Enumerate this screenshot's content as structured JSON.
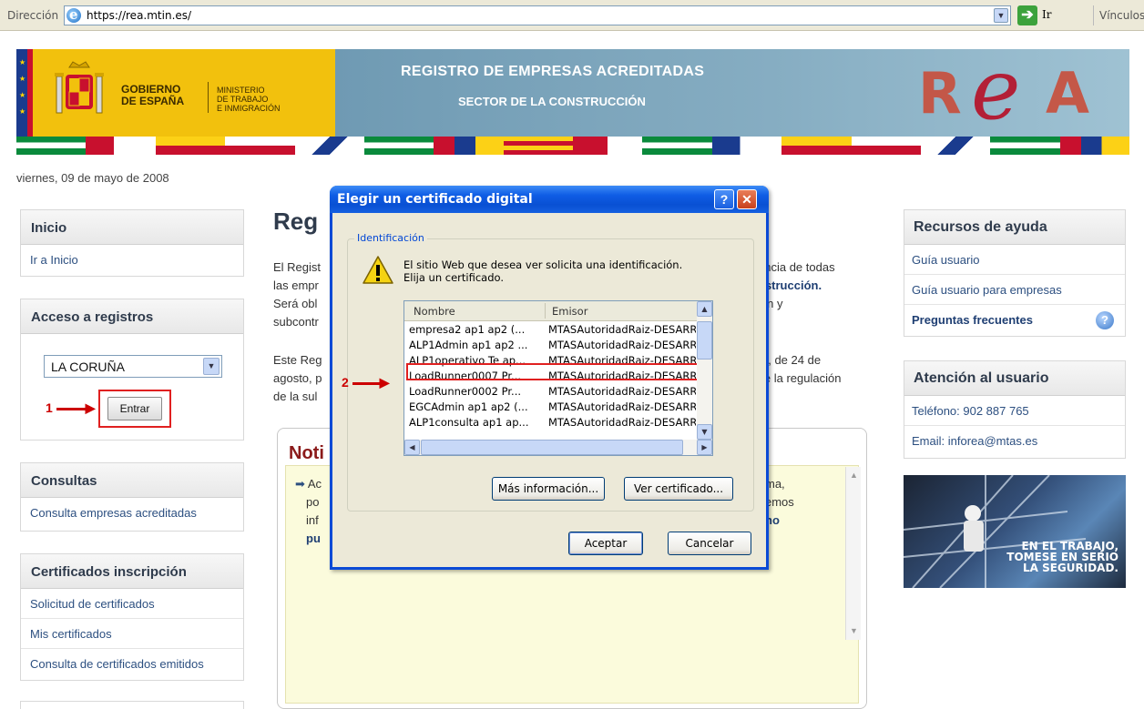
{
  "browser": {
    "address_label": "Dirección",
    "url": "https://rea.mtin.es/",
    "go_label": "Ir",
    "links_label": "Vínculos"
  },
  "banner": {
    "gobierno": "GOBIERNO\nDE ESPAÑA",
    "ministerio": "MINISTERIO\nDE TRABAJO\nE INMIGRACIÓN",
    "title": "REGISTRO DE EMPRESAS ACREDITADAS",
    "subtitle": "SECTOR DE LA CONSTRUCCIÓN",
    "logo_text": "REA"
  },
  "date": "viernes, 09 de mayo de 2008",
  "left": {
    "inicio": {
      "title": "Inicio",
      "items": [
        "Ir a Inicio"
      ]
    },
    "acceso": {
      "title": "Acceso a registros",
      "selected_province": "LA CORUÑA",
      "enter_label": "Entrar"
    },
    "consultas": {
      "title": "Consultas",
      "items": [
        "Consulta empresas acreditadas"
      ]
    },
    "certificados": {
      "title": "Certificados inscripción",
      "items": [
        "Solicitud de certificados",
        "Mis certificados",
        "Consulta de certificados emitidos"
      ]
    }
  },
  "center": {
    "title": "Reg",
    "p1": [
      "El Regist",
      "las empr",
      "Será obl",
      "subcontr"
    ],
    "p1_right": [
      "encia de todas",
      "nstrucción.",
      "ión y",
      ""
    ],
    "p2": [
      "Este Reg",
      "agosto, p",
      "de la sul"
    ],
    "p2_right": [
      "7, de 24 de",
      "le la regulación",
      ""
    ],
    "news_title": "Noti",
    "news_left": [
      "Ac",
      "po",
      "inf",
      "pu"
    ],
    "news_right": [
      "ma,",
      "emos",
      "no",
      ""
    ]
  },
  "right": {
    "recursos": {
      "title": "Recursos de ayuda",
      "items": [
        "Guía usuario",
        "Guía usuario para empresas",
        "Preguntas frecuentes"
      ]
    },
    "atencion": {
      "title": "Atención al usuario",
      "items": [
        "Teléfono: 902 887 765",
        "Email: inforea@mtas.es"
      ]
    },
    "banner_text": "EN EL TRABAJO,\nTOMESE EN SERIO\nLA SEGURIDAD."
  },
  "dialog": {
    "title": "Elegir un certificado digital",
    "group_label": "Identificación",
    "message_line1": "El sitio Web que desea ver solicita una identificación.",
    "message_line2": "Elija un certificado.",
    "columns": [
      "Nombre",
      "Emisor"
    ],
    "rows": [
      {
        "name": "empresa2 ap1 ap2 (...",
        "issuer": "MTASAutoridadRaiz-DESARR."
      },
      {
        "name": "ALP1Admin ap1 ap2 ...",
        "issuer": "MTASAutoridadRaiz-DESARR."
      },
      {
        "name": "ALP1operativo Te ap...",
        "issuer": "MTASAutoridadRaiz-DESARR."
      },
      {
        "name": "LoadRunner0007 Pr...",
        "issuer": "MTASAutoridadRaiz-DESARR."
      },
      {
        "name": "LoadRunner0002 Pr...",
        "issuer": "MTASAutoridadRaiz-DESARR."
      },
      {
        "name": "EGCAdmin ap1 ap2 (...",
        "issuer": "MTASAutoridadRaiz-DESARR."
      },
      {
        "name": "ALP1consulta ap1 ap...",
        "issuer": "MTASAutoridadRaiz-DESARR."
      }
    ],
    "more_info_label": "Más información...",
    "view_cert_label": "Ver certificado...",
    "accept_label": "Aceptar",
    "cancel_label": "Cancelar"
  },
  "annotations": {
    "step1": "1",
    "step2": "2"
  },
  "colors": {
    "brand_yellow": "#f2c10d",
    "banner_blue": "#7aa3bb",
    "xp_title": "#0a4ad6",
    "highlight_red": "#e02020"
  }
}
